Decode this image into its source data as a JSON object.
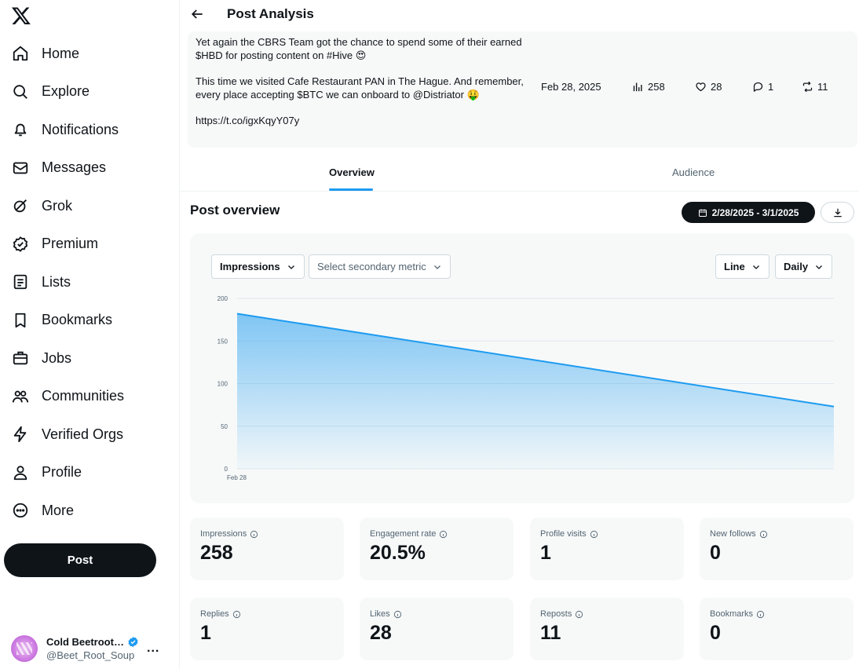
{
  "nav": {
    "items": [
      {
        "label": "Home",
        "icon": "home-icon"
      },
      {
        "label": "Explore",
        "icon": "search-icon"
      },
      {
        "label": "Notifications",
        "icon": "bell-icon"
      },
      {
        "label": "Messages",
        "icon": "envelope-icon"
      },
      {
        "label": "Grok",
        "icon": "grok-icon"
      },
      {
        "label": "Premium",
        "icon": "premium-icon"
      },
      {
        "label": "Lists",
        "icon": "list-icon"
      },
      {
        "label": "Bookmarks",
        "icon": "bookmark-icon"
      },
      {
        "label": "Jobs",
        "icon": "briefcase-icon"
      },
      {
        "label": "Communities",
        "icon": "communities-icon"
      },
      {
        "label": "Verified Orgs",
        "icon": "lightning-icon"
      },
      {
        "label": "Profile",
        "icon": "person-icon"
      },
      {
        "label": "More",
        "icon": "more-circle-icon"
      }
    ],
    "post_label": "Post"
  },
  "account": {
    "name": "Cold Beetroot S...",
    "handle": "@Beet_Root_Soup",
    "more": "..."
  },
  "header": {
    "title": "Post Analysis"
  },
  "tweet": {
    "line1": "Yet again the CBRS Team got the chance to spend some of their earned $HBD for posting content on #Hive 😍",
    "line2": "This time we visited Cafe Restaurant PAN in The Hague. And remember, every place accepting $BTC we can onboard to @Distriator 🤑",
    "link": "https://t.co/igxKqyY07y",
    "date": "Feb 28, 2025",
    "views": "258",
    "likes": "28",
    "replies": "1",
    "reposts": "11"
  },
  "tabs": {
    "overview": "Overview",
    "audience": "Audience"
  },
  "overview": {
    "title": "Post overview",
    "date_range": "2/28/2025 - 3/1/2025"
  },
  "controls": {
    "primary_metric": "Impressions",
    "secondary_metric": "Select secondary metric",
    "chart_type": "Line",
    "interval": "Daily"
  },
  "chart_data": {
    "type": "area",
    "x": [
      "Feb 28",
      ""
    ],
    "series": [
      {
        "values": [
          182,
          73
        ]
      }
    ],
    "ylim": [
      0,
      200
    ],
    "yticks": [
      0,
      50,
      100,
      150,
      200
    ],
    "xtick_labels": [
      "Feb 28"
    ],
    "grid": true,
    "color": "#1d9bf0"
  },
  "metrics": [
    {
      "label": "Impressions",
      "value": "258"
    },
    {
      "label": "Engagement rate",
      "value": "20.5%"
    },
    {
      "label": "Profile visits",
      "value": "1"
    },
    {
      "label": "New follows",
      "value": "0"
    },
    {
      "label": "Replies",
      "value": "1"
    },
    {
      "label": "Likes",
      "value": "28"
    },
    {
      "label": "Reposts",
      "value": "11"
    },
    {
      "label": "Bookmarks",
      "value": "0"
    }
  ]
}
